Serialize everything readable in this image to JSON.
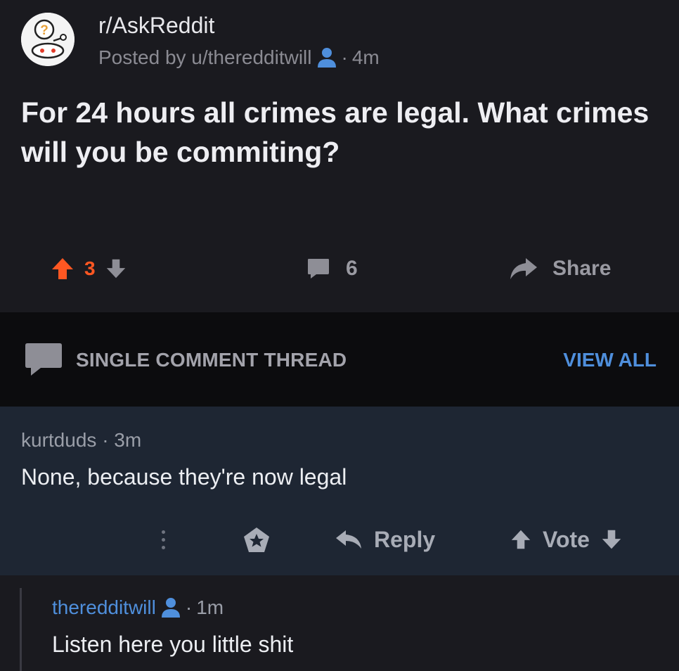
{
  "post": {
    "subreddit": "r/AskReddit",
    "posted_by_prefix": "Posted by u/theredditwill",
    "age": "4m",
    "title": "For 24 hours all crimes are legal. What crimes will you be commiting?",
    "score": "3",
    "comment_count": "6",
    "share_label": "Share"
  },
  "thread": {
    "label": "SINGLE COMMENT THREAD",
    "view_all_label": "VIEW ALL"
  },
  "comment": {
    "author": "kurtduds",
    "age": "3m",
    "body": "None, because they're now legal",
    "reply_label": "Reply",
    "vote_label": "Vote"
  },
  "reply": {
    "author": "theredditwill",
    "age": "1m",
    "body": "Listen here you little shit"
  },
  "colors": {
    "upvote": "#ff5722",
    "link_blue": "#4f8fdc",
    "op_icon": "#4f8fdc"
  }
}
